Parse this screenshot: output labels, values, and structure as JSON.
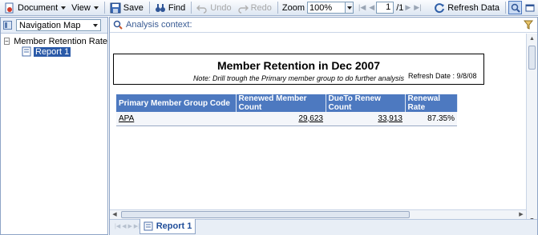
{
  "toolbar": {
    "document_label": "Document",
    "view_label": "View",
    "save_label": "Save",
    "find_label": "Find",
    "undo_label": "Undo",
    "redo_label": "Redo",
    "zoom_label": "Zoom",
    "zoom_value": "100%",
    "page_value": "1",
    "page_total": "/1",
    "refresh_label": "Refresh Data"
  },
  "left_panel": {
    "selector_value": "Navigation Map",
    "tree": {
      "root_label": "Member Retention Rate",
      "child_label": "Report 1"
    }
  },
  "right_panel": {
    "context_label": "Analysis context:",
    "tab_label": "Report 1"
  },
  "report": {
    "title": "Member Retention in Dec  2007",
    "note": "Note: Drill trough the Primary member group to do further analysis",
    "refresh_date": "Refresh Date : 9/8/08",
    "columns": [
      "Primary Member Group Code",
      "Renewed Member Count",
      "DueTo Renew Count",
      "Renewal Rate"
    ],
    "rows": [
      [
        "APA",
        "29,623",
        "33,913",
        "87.35%"
      ]
    ]
  },
  "colors": {
    "header_blue": "#4d79c0",
    "toolbar_gradient_end": "#dde6f2",
    "selected_tree": "#2b5aa8"
  }
}
